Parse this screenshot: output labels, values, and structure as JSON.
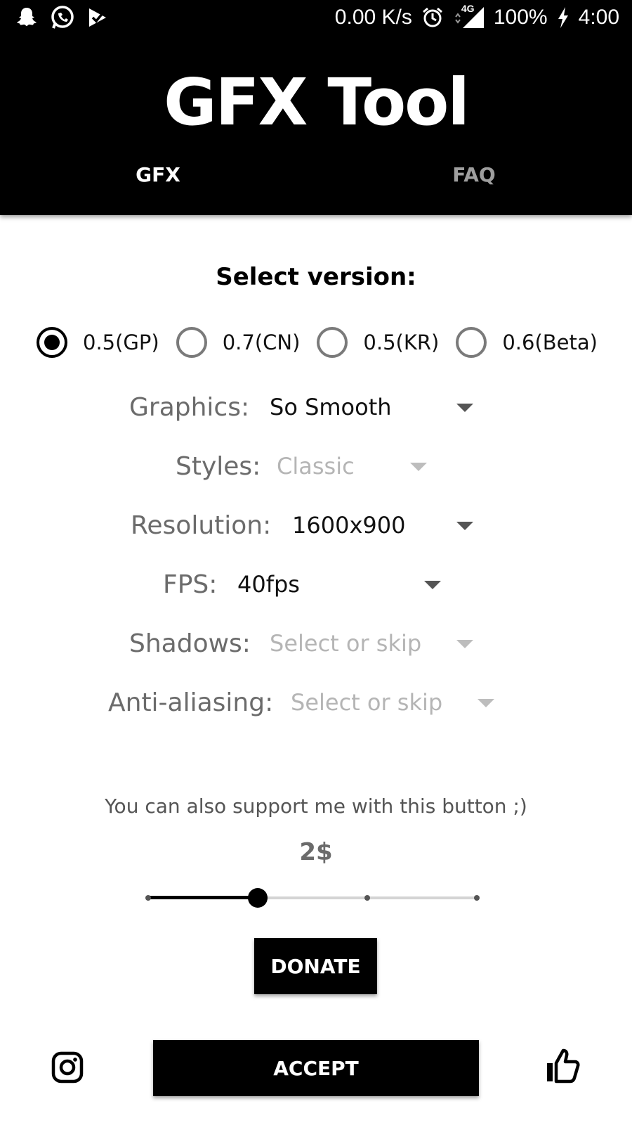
{
  "status_bar": {
    "network_speed": "0.00 K/s",
    "network_type": "4G",
    "battery": "100%",
    "time": "4:00",
    "icons": [
      "snapchat-icon",
      "whatsapp-icon",
      "play-games-icon",
      "alarm-icon",
      "signal-icon",
      "charging-icon"
    ]
  },
  "header": {
    "title": "GFX Tool",
    "tabs": [
      {
        "label": "GFX",
        "active": true
      },
      {
        "label": "FAQ",
        "active": false
      }
    ]
  },
  "version": {
    "title": "Select version:",
    "options": [
      "0.5(GP)",
      "0.7(CN)",
      "0.5(KR)",
      "0.6(Beta)"
    ],
    "selected": "0.5(GP)"
  },
  "settings": [
    {
      "label": "Graphics:",
      "value": "So Smooth",
      "enabled": true
    },
    {
      "label": "Styles:",
      "value": "Classic",
      "enabled": false
    },
    {
      "label": "Resolution:",
      "value": "1600x900",
      "enabled": true
    },
    {
      "label": "FPS:",
      "value": "40fps",
      "enabled": true
    },
    {
      "label": "Shadows:",
      "value": "Select or skip",
      "enabled": false
    },
    {
      "label": "Anti-aliasing:",
      "value": "Select or skip",
      "enabled": false
    }
  ],
  "support": {
    "text": "You can also support me with this button ;)",
    "amount": "2$",
    "slider_steps": 4,
    "slider_selected_index": 1,
    "donate_label": "DONATE"
  },
  "footer": {
    "accept_label": "ACCEPT",
    "left_icon": "instagram-icon",
    "right_icon": "thumbs-up-icon"
  },
  "colors": {
    "header_bg": "#000000",
    "tab_active": "#ffffff",
    "tab_inactive": "#9e9e9e",
    "button_bg": "#000000",
    "button_text": "#ffffff"
  }
}
